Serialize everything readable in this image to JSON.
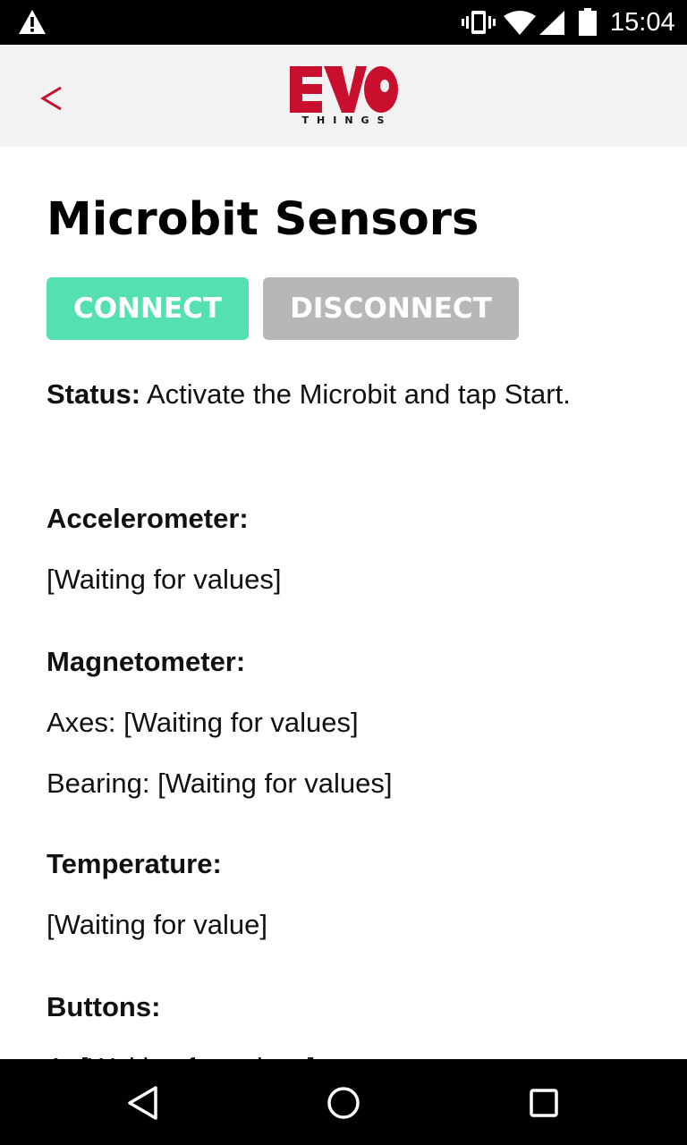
{
  "status_bar": {
    "time": "15:04",
    "icons": [
      "alert-icon",
      "vibrate-icon",
      "wifi-icon",
      "cell-signal-icon",
      "battery-icon"
    ]
  },
  "header": {
    "back_glyph": "<",
    "logo": {
      "main": "EVO",
      "sub": "THINGS",
      "brand_color": "#c8102e"
    }
  },
  "page": {
    "title": "Microbit Sensors",
    "buttons": {
      "connect": "CONNECT",
      "disconnect": "DISCONNECT"
    },
    "colors": {
      "connect_bg": "#54e0b0",
      "disconnect_bg": "#b7b7b7"
    },
    "status": {
      "label": "Status:",
      "text": " Activate the Microbit and tap Start."
    },
    "accelerometer": {
      "title": "Accelerometer:",
      "value": "[Waiting for values]"
    },
    "magnetometer": {
      "title": "Magnetometer:",
      "axes": "Axes: [Waiting for values]",
      "bearing": "Bearing: [Waiting for values]"
    },
    "temperature": {
      "title": "Temperature:",
      "value": "[Waiting for value]"
    },
    "buttons_section": {
      "title": "Buttons:",
      "partial_line": "A: [Waiting for values]"
    }
  },
  "nav_bar": {
    "icons": [
      "nav-back-icon",
      "nav-home-icon",
      "nav-recents-icon"
    ]
  }
}
